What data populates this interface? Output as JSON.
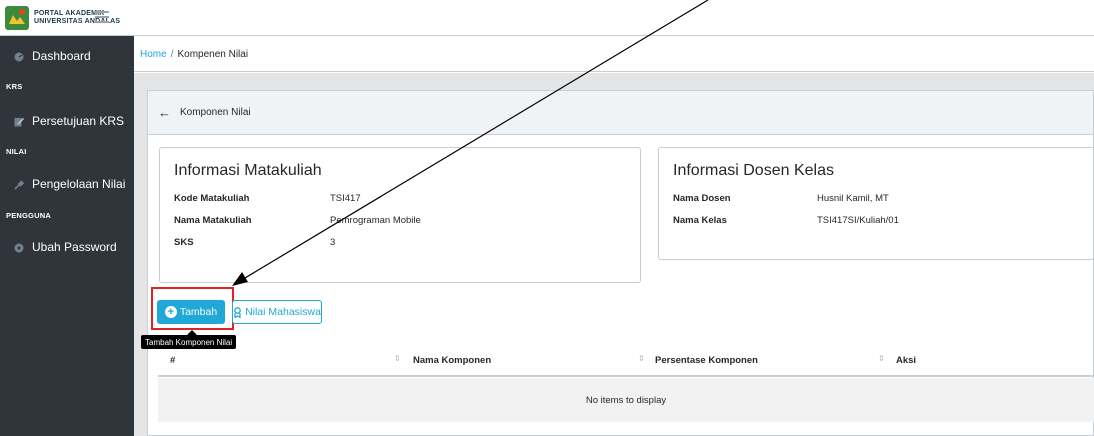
{
  "brand": {
    "line1": "PORTAL AKADEMIK",
    "line2": "UNIVERSITAS ANDALAS"
  },
  "sidebar": {
    "items": [
      {
        "label": "Dashboard"
      },
      {
        "section": "KRS"
      },
      {
        "label": "Persetujuan KRS"
      },
      {
        "section": "NILAI"
      },
      {
        "label": "Pengelolaan Nilai"
      },
      {
        "section": "PENGGUNA"
      },
      {
        "label": "Ubah Password"
      }
    ]
  },
  "breadcrumb": {
    "home": "Home",
    "separator": "/",
    "current": "Kompenen Nilai"
  },
  "card": {
    "title": "Komponen Nilai"
  },
  "matakuliah": {
    "title": "Informasi Matakuliah",
    "rows": [
      {
        "key": "Kode Matakuliah",
        "value": "TSI417"
      },
      {
        "key": "Nama Matakuliah",
        "value": "Pemrograman Mobile"
      },
      {
        "key": "SKS",
        "value": "3"
      }
    ]
  },
  "dosen": {
    "title": "Informasi Dosen Kelas",
    "rows": [
      {
        "key": "Nama Dosen",
        "value": "Husnil Kamil, MT"
      },
      {
        "key": "Nama Kelas",
        "value": "TSI417SI/Kuliah/01"
      }
    ]
  },
  "actions": {
    "tambah": "Tambah",
    "nilai": "Nilai Mahasiswa",
    "tooltip": "Tambah Komponen Nilai"
  },
  "table": {
    "headers": [
      "#",
      "Nama Komponen",
      "Persentase Komponen",
      "Aksi"
    ],
    "empty": "No items to display"
  },
  "colors": {
    "primary": "#20a8d8",
    "sidebar": "#2f353a",
    "highlight": "#e0231f"
  },
  "icons": [
    "logo-icon",
    "hamburger-icon",
    "dashboard-icon",
    "edit-icon",
    "gavel-icon",
    "key-icon",
    "back-arrow-icon",
    "plus-circle-icon",
    "user-icon",
    "sort-icon"
  ]
}
